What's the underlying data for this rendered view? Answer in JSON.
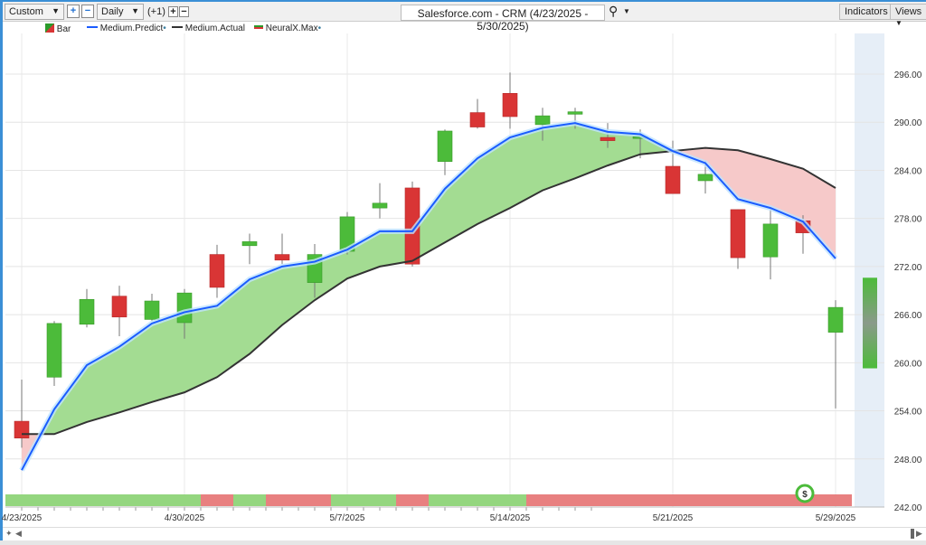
{
  "toolbar": {
    "range_select": "Custom",
    "interval_select": "Daily",
    "offset": "(+1)",
    "title": "Salesforce.com - CRM (4/23/2025 - 5/30/2025)",
    "indicators": "Indicators",
    "views": "Views",
    "plus": "+",
    "minus": "−"
  },
  "legend": [
    {
      "label": "Bar",
      "color": "#22aa22"
    },
    {
      "label": "Medium.Predict",
      "color": "#1a5cff"
    },
    {
      "label": "Medium.Actual",
      "color": "#333333"
    },
    {
      "label": "NeuralX.Max",
      "color": "#2a9a2a"
    }
  ],
  "colors": {
    "up": "#4cbb3a",
    "down": "#d93535",
    "predict": "#1a5cff",
    "actual": "#333333",
    "fill_up": "#a3dc92",
    "fill_down": "#f6c9c9",
    "signal_up": "#94d67f",
    "signal_down": "#e88080",
    "future_band": "#e6eef7"
  },
  "chart_data": {
    "type": "candlestick",
    "ylim": [
      242,
      298
    ],
    "y_ticks": [
      "296.00",
      "290.00",
      "284.00",
      "278.00",
      "272.00",
      "266.00",
      "260.00",
      "254.00",
      "248.00",
      "242.00"
    ],
    "x_labels": [
      {
        "index": 0,
        "label": "4/23/2025"
      },
      {
        "index": 5,
        "label": "4/30/2025"
      },
      {
        "index": 10,
        "label": "5/7/2025"
      },
      {
        "index": 15,
        "label": "5/14/2025"
      },
      {
        "index": 20,
        "label": "5/21/2025"
      },
      {
        "index": 25,
        "label": "5/29/2025"
      }
    ],
    "candles": [
      [
        252.7,
        257.9,
        249.4,
        250.6
      ],
      [
        258.2,
        265.2,
        257.1,
        264.9
      ],
      [
        264.8,
        269.2,
        264.4,
        267.9
      ],
      [
        268.3,
        269.6,
        263.3,
        265.7
      ],
      [
        265.4,
        268.6,
        265.2,
        267.7
      ],
      [
        265.0,
        269.2,
        263.0,
        268.7
      ],
      [
        273.5,
        274.7,
        268.1,
        269.4
      ],
      [
        274.6,
        276.1,
        272.3,
        275.1
      ],
      [
        273.5,
        276.1,
        272.3,
        272.8
      ],
      [
        270.0,
        274.8,
        268.1,
        273.5
      ],
      [
        273.9,
        278.8,
        273.5,
        278.2
      ],
      [
        279.3,
        282.4,
        278.0,
        279.9
      ],
      [
        281.8,
        282.6,
        272.0,
        272.3
      ],
      [
        285.1,
        289.1,
        283.4,
        288.9
      ],
      [
        291.2,
        292.9,
        289.2,
        289.4
      ],
      [
        293.6,
        296.2,
        289.2,
        290.7
      ],
      [
        289.7,
        291.8,
        287.7,
        290.8
      ],
      [
        291.0,
        291.8,
        289.2,
        291.3
      ],
      [
        288.1,
        289.9,
        286.8,
        287.7
      ],
      [
        288.1,
        289.1,
        285.5,
        288.2
      ],
      [
        284.5,
        287.7,
        281.1,
        281.1
      ],
      [
        282.7,
        285.2,
        281.1,
        283.5
      ],
      [
        279.1,
        279.1,
        271.7,
        273.1
      ],
      [
        273.2,
        279.3,
        270.4,
        277.3
      ],
      [
        277.7,
        278.4,
        273.6,
        276.2
      ],
      [
        263.8,
        267.8,
        254.3,
        266.9
      ]
    ],
    "candle_format": "open,high,low,close",
    "predict": [
      246.6,
      254.2,
      259.7,
      262.0,
      264.9,
      266.3,
      267.1,
      270.4,
      272.0,
      272.6,
      274.1,
      276.4,
      276.4,
      281.7,
      285.5,
      288.1,
      289.3,
      289.9,
      288.8,
      288.5,
      286.4,
      284.9,
      280.4,
      279.3,
      277.6,
      273.0
    ],
    "actual": [
      251.1,
      251.1,
      252.6,
      253.8,
      255.1,
      256.3,
      258.2,
      261.1,
      264.7,
      267.8,
      270.5,
      272.0,
      272.7,
      275.0,
      277.3,
      279.3,
      281.5,
      283.0,
      284.6,
      286.0,
      286.4,
      286.8,
      286.5,
      285.4,
      284.2,
      281.8
    ],
    "signals": [
      1,
      1,
      1,
      1,
      1,
      1,
      0,
      1,
      0,
      0,
      1,
      1,
      0,
      1,
      1,
      1,
      0,
      0,
      0,
      0,
      0,
      0,
      0,
      0,
      0,
      0
    ],
    "forecast_range": [
      259.3,
      270.6
    ],
    "marker_label": "$",
    "marker_index": 24
  }
}
